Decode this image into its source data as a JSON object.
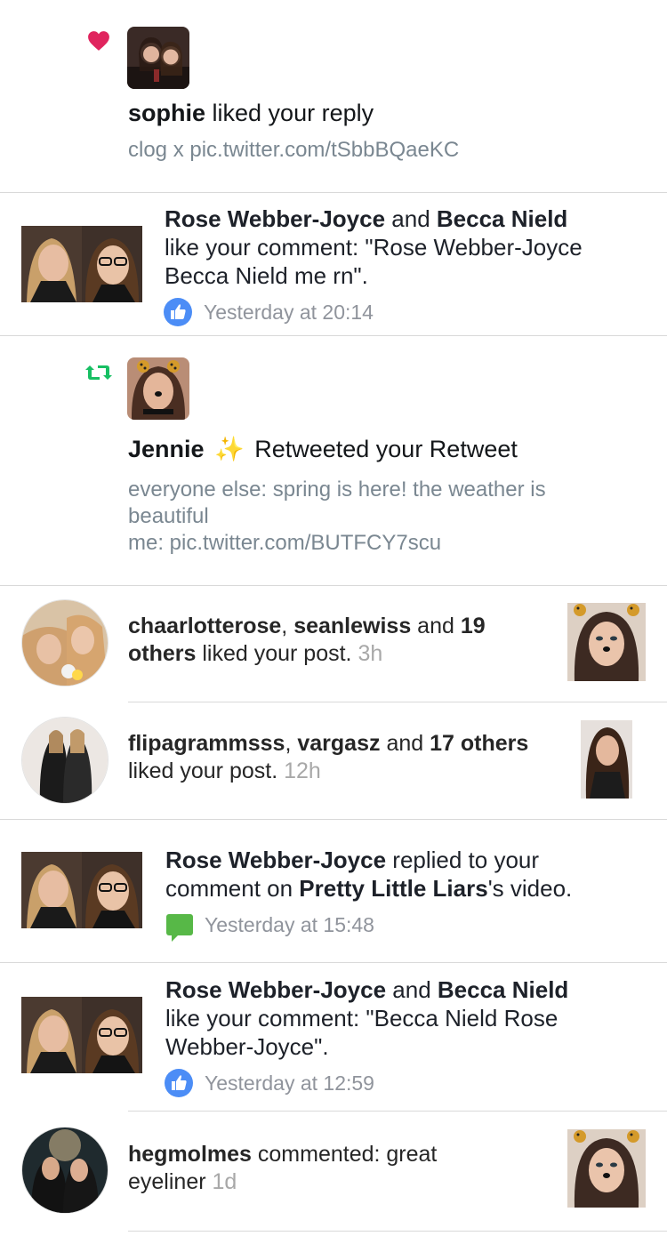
{
  "notifications": [
    {
      "kind": "twitter_like",
      "icon": "heart-icon",
      "actor": "sophie",
      "action": " liked your reply",
      "tweet_text": "clog x pic.twitter.com/tSbbBQaeKC"
    },
    {
      "kind": "facebook_like",
      "icon": "thumbs-up-icon",
      "actor1": "Rose Webber-Joyce",
      "conj": " and ",
      "actor2": "Becca Nield",
      "text": "like your comment: \"Rose Webber-Joyce Becca Nield me rn\".",
      "time": "Yesterday at 20:14"
    },
    {
      "kind": "twitter_retweet",
      "icon": "retweet-icon",
      "actor": "Jennie",
      "emoji": "✨",
      "action": "Retweeted your Retweet",
      "tweet_line1": "everyone else: spring is here! the weather is",
      "tweet_line2": "beautiful",
      "tweet_line3": "me: pic.twitter.com/BUTFCY7scu"
    },
    {
      "kind": "instagram_like",
      "user1": "chaarlotterose",
      "sep": ", ",
      "user2": "seanlewiss",
      "conj": " and ",
      "count": "19",
      "others": "others",
      "text": " liked your post. ",
      "time": "3h"
    },
    {
      "kind": "instagram_like",
      "user1": "flipagrammsss",
      "sep": ", ",
      "user2": "vargasz",
      "conj": " and ",
      "count": "17 others",
      "text": "liked your post. ",
      "time": "12h"
    },
    {
      "kind": "facebook_reply",
      "icon": "comment-icon",
      "actor": "Rose Webber-Joyce",
      "text1": " replied to your",
      "text2": "comment on ",
      "page": "Pretty Little Liars",
      "text3": "'s video.",
      "time": "Yesterday at 15:48"
    },
    {
      "kind": "facebook_like",
      "icon": "thumbs-up-icon",
      "actor1": "Rose Webber-Joyce",
      "conj": " and ",
      "actor2": "Becca Nield",
      "text": "like your comment: \"Becca Nield Rose Webber-Joyce\".",
      "time": "Yesterday at 12:59"
    },
    {
      "kind": "instagram_comment",
      "user": "hegmolmes",
      "text": " commented: great",
      "text2": "eyeliner ",
      "time": "1d"
    }
  ],
  "colors": {
    "twitter_heart": "#e0245e",
    "twitter_retweet": "#17bf63",
    "facebook_like": "#4c8df6",
    "facebook_comment": "#57b847"
  }
}
